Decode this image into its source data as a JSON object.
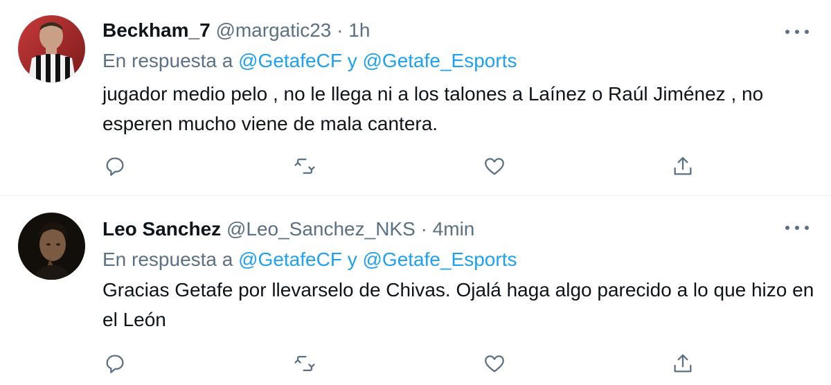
{
  "tweets": [
    {
      "display_name": "Beckham_7",
      "handle": "@margatic23",
      "separator": "·",
      "time": "1h",
      "reply_prefix": "En respuesta a",
      "reply_mention_1": "@GetafeCF",
      "reply_joiner": "y",
      "reply_mention_2": "@Getafe_Esports",
      "text": "jugador medio pelo , no le llega ni a los talones a Laínez o Raúl Jiménez , no esperen mucho viene de mala cantera."
    },
    {
      "display_name": "Leo Sanchez",
      "handle": "@Leo_Sanchez_NKS",
      "separator": "·",
      "time": "4min",
      "reply_prefix": "En respuesta a",
      "reply_mention_1": "@GetafeCF",
      "reply_joiner": "y",
      "reply_mention_2": "@Getafe_Esports",
      "text": "Gracias Getafe por llevarselo de Chivas. Ojalá haga algo parecido a lo que hizo en el León"
    }
  ],
  "colors": {
    "text": "#0f1419",
    "secondary": "#5b7083",
    "accent": "#1da1f2",
    "divider": "#e6ecf0"
  },
  "icons": [
    "reply-icon",
    "retweet-icon",
    "like-icon",
    "share-icon",
    "more-icon"
  ]
}
